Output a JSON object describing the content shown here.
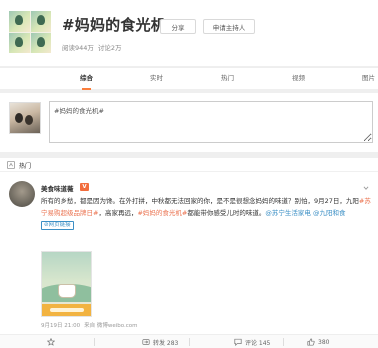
{
  "topic": {
    "title": "#妈妈的食光机#",
    "share_label": "分享",
    "host_label": "申请主持人",
    "reads": "阅读944万",
    "discussions": "讨论2万"
  },
  "tabs": [
    {
      "label": "综合",
      "active": true
    },
    {
      "label": "实时",
      "active": false
    },
    {
      "label": "热门",
      "active": false
    },
    {
      "label": "视频",
      "active": false
    },
    {
      "label": "图片",
      "active": false
    }
  ],
  "compose": {
    "value": "#妈妈的食光机#"
  },
  "hot": {
    "label": "热门"
  },
  "post": {
    "author": "美食味道薇",
    "badge": "V",
    "text_1": "所有的乡愁，都是因为馋。在外打拼，中秋都无法回家的你，是不是很想念妈妈的味道？别怕，9月27日，九阳",
    "tag_1": "#苏宁易购超级品牌日#",
    "text_2": "，高家再远，",
    "tag_2": "#妈妈的食光机#",
    "text_3": "都能带你感受儿时的味道。",
    "mention_1": "@苏宁生活家电",
    "mention_2": "@九阳和食",
    "web_link": "网页链接",
    "time": "9月19日 21:00",
    "source": "来自 微博weibo.com"
  },
  "actions": {
    "favorite": "",
    "forward": "转发 283",
    "comment": "评论 145",
    "like": "380"
  },
  "colors": {
    "accent": "#fa7d3c",
    "link": "#eb7350",
    "mention": "#3b8fc5"
  }
}
